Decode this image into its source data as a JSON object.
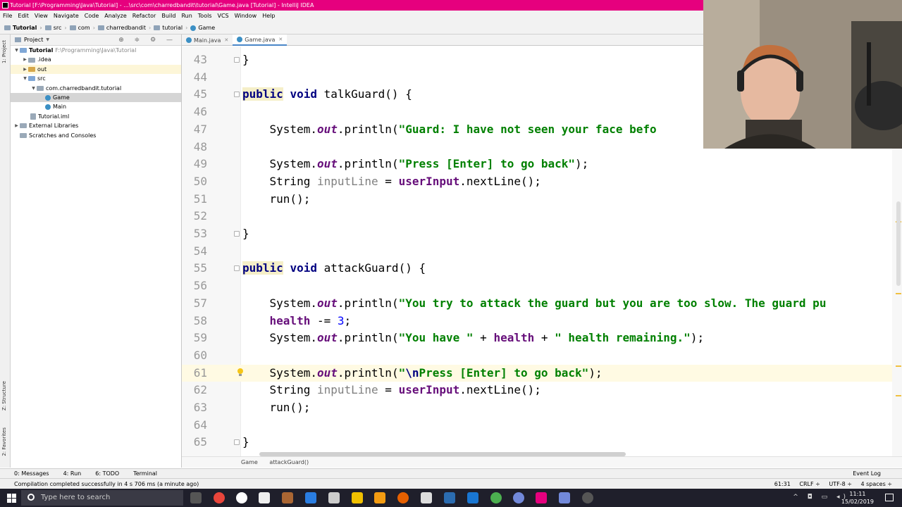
{
  "window": {
    "title": "Tutorial [F:\\Programming\\Java\\Tutorial] - ...\\src\\com\\charredbandit\\tutorial\\Game.java [Tutorial] - IntelliJ IDEA"
  },
  "menu": [
    "File",
    "Edit",
    "View",
    "Navigate",
    "Code",
    "Analyze",
    "Refactor",
    "Build",
    "Run",
    "Tools",
    "VCS",
    "Window",
    "Help"
  ],
  "navbar": {
    "crumbs": [
      "Tutorial",
      "src",
      "com",
      "charredbandit",
      "tutorial",
      "Game"
    ]
  },
  "left_tabs": {
    "project": "1: Project",
    "structure": "Z: Structure",
    "favorites": "2: Favorites"
  },
  "project_panel": {
    "title": "Project",
    "tree": [
      {
        "label": "Tutorial",
        "extra": "F:\\Programming\\Java\\Tutorial",
        "depth": 0,
        "icon": "folder-icon",
        "expanded": true
      },
      {
        "label": ".idea",
        "depth": 1,
        "icon": "folder-icon",
        "expanded": false
      },
      {
        "label": "out",
        "depth": 1,
        "icon": "folder-icon",
        "expanded": false
      },
      {
        "label": "src",
        "depth": 1,
        "icon": "folder-icon",
        "expanded": true
      },
      {
        "label": "com.charredbandit.tutorial",
        "depth": 2,
        "icon": "package-icon",
        "expanded": true
      },
      {
        "label": "Game",
        "depth": 3,
        "icon": "class-icon",
        "selected": true
      },
      {
        "label": "Main",
        "depth": 3,
        "icon": "class-icon"
      },
      {
        "label": "Tutorial.iml",
        "depth": 1,
        "icon": "file-icon"
      },
      {
        "label": "External Libraries",
        "depth": 0,
        "icon": "library-icon",
        "expanded": false
      },
      {
        "label": "Scratches and Consoles",
        "depth": 0,
        "icon": "scratch-icon"
      }
    ]
  },
  "editor_tabs": [
    {
      "label": "Main.java",
      "active": false
    },
    {
      "label": "Game.java",
      "active": true
    }
  ],
  "code": {
    "lines": [
      {
        "n": "43",
        "text": "}"
      },
      {
        "n": "44",
        "text": ""
      },
      {
        "n": "45",
        "text": "public void talkGuard() {"
      },
      {
        "n": "46",
        "text": ""
      },
      {
        "n": "47",
        "text": "    System.out.println(\"Guard: I have not seen your face befo"
      },
      {
        "n": "48",
        "text": ""
      },
      {
        "n": "49",
        "text": "    System.out.println(\"Press [Enter] to go back\");"
      },
      {
        "n": "50",
        "text": "    String inputLine = userInput.nextLine();"
      },
      {
        "n": "51",
        "text": "    run();"
      },
      {
        "n": "52",
        "text": ""
      },
      {
        "n": "53",
        "text": "}"
      },
      {
        "n": "54",
        "text": ""
      },
      {
        "n": "55",
        "text": "public void attackGuard() {"
      },
      {
        "n": "56",
        "text": ""
      },
      {
        "n": "57",
        "text": "    System.out.println(\"You try to attack the guard but you are too slow. The guard pu"
      },
      {
        "n": "58",
        "text": "    health -= 3;"
      },
      {
        "n": "59",
        "text": "    System.out.println(\"You have \" + health + \" health remaining.\");"
      },
      {
        "n": "60",
        "text": ""
      },
      {
        "n": "61",
        "text": "    System.out.println(\"\\nPress [Enter] to go back\");"
      },
      {
        "n": "62",
        "text": "    String inputLine = userInput.nextLine();"
      },
      {
        "n": "63",
        "text": "    run();"
      },
      {
        "n": "64",
        "text": ""
      },
      {
        "n": "65",
        "text": "}"
      }
    ],
    "current_line": "61"
  },
  "editor_breadcrumb": [
    "Game",
    "attackGuard()"
  ],
  "bottom_tools": {
    "messages": "0: Messages",
    "run": "4: Run",
    "todo": "6: TODO",
    "terminal": "Terminal",
    "event_log": "Event Log"
  },
  "status": {
    "message": "Compilation completed successfully in 4 s 706 ms (a minute ago)",
    "position": "61:31",
    "line_sep": "CRLF ÷",
    "encoding": "UTF-8 ÷",
    "indent": "4 spaces ÷"
  },
  "taskbar": {
    "search_placeholder": "Type here to search",
    "time": "11:11",
    "date": "15/02/2019"
  },
  "colors": {
    "titlebar": "#e6007e",
    "keyword": "#000080",
    "string": "#008000",
    "field": "#660e7a",
    "number": "#0000ff",
    "current_line": "#fffae3"
  }
}
